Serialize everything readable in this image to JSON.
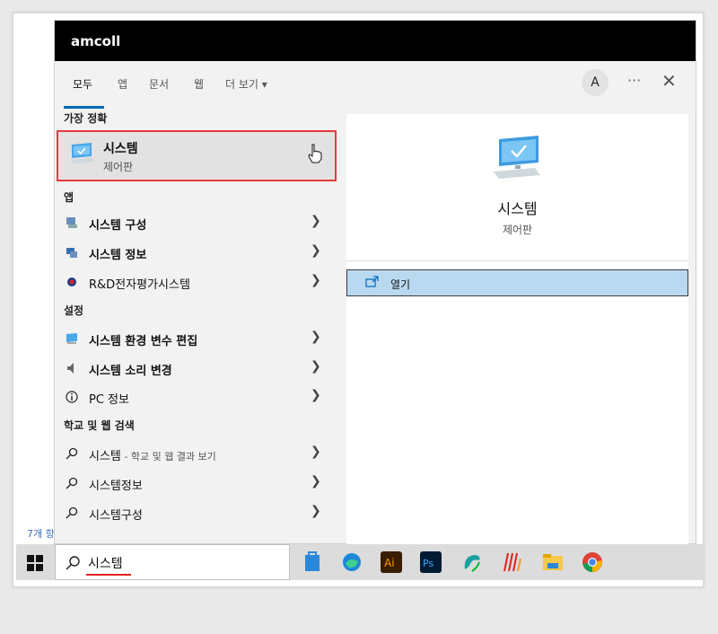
{
  "panel": {
    "app_name": "amcoll",
    "tabs": [
      "모두",
      "앱",
      "문서",
      "웹",
      "더 보기 ▾"
    ],
    "avatar_letter": "A",
    "more_label": "···",
    "close_label": "✕"
  },
  "best_match": {
    "section": "가장 정확",
    "name": "시스템",
    "subtitle": "제어판"
  },
  "apps": {
    "section": "앱",
    "items": [
      "시스템 구성",
      "시스템 정보",
      "R&D전자평가시스템"
    ]
  },
  "settings": {
    "section": "설정",
    "items": [
      "시스템 환경 변수 편집",
      "시스템 소리 변경",
      "PC 정보"
    ]
  },
  "web": {
    "section": "학교 및 웹 검색",
    "items": [
      {
        "main": "시스템",
        "hint": " - 학교 및 웹 결과 보기"
      },
      {
        "main": "시스템정보",
        "hint": ""
      },
      {
        "main": "시스템구성",
        "hint": ""
      }
    ]
  },
  "preview": {
    "title": "시스템",
    "subtitle": "제어판",
    "open_label": "열기"
  },
  "desktop": {
    "count_text": "7개 항"
  },
  "taskbar": {
    "search_value": "시스템",
    "apps": [
      "store-icon",
      "edge-icon",
      "illustrator-icon",
      "photoshop-icon",
      "app-icon",
      "app2-icon",
      "file-explorer-icon",
      "chrome-icon"
    ]
  },
  "colors": {
    "highlight_border": "#e8393e",
    "open_row_bg": "#b9d9f1",
    "accent": "#0067c0"
  }
}
